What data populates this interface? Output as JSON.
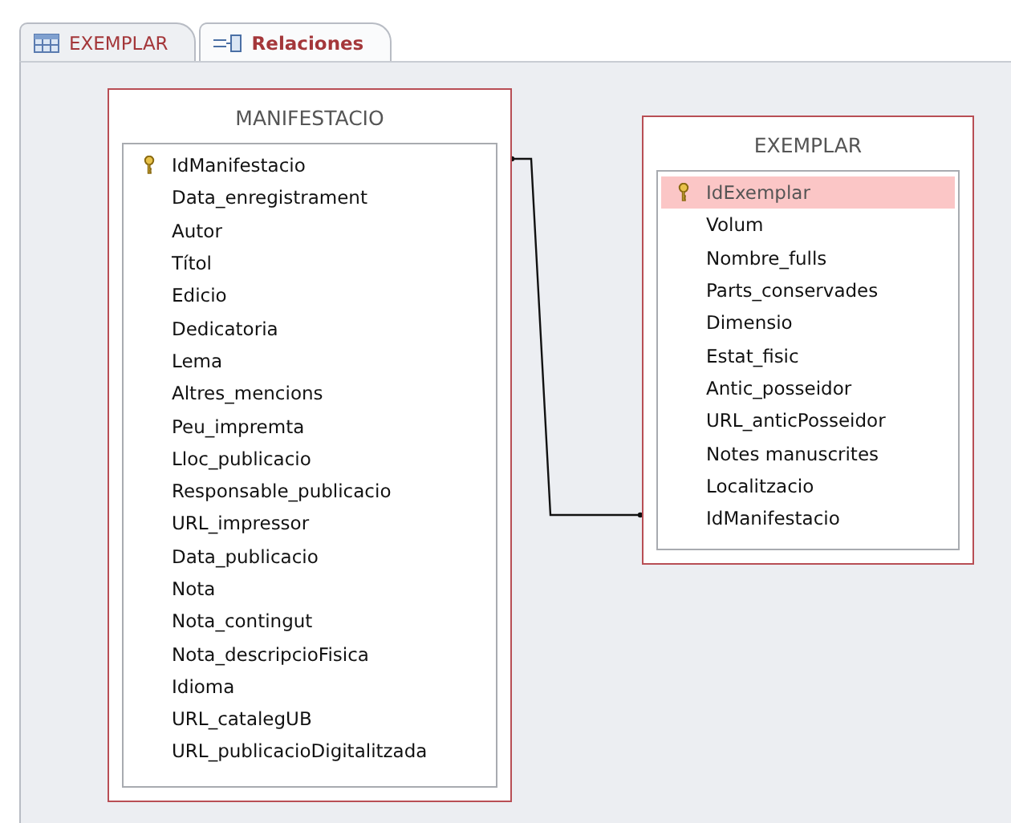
{
  "tabs": [
    {
      "label": "EXEMPLAR",
      "kind": "table",
      "selected": false
    },
    {
      "label": "Relaciones",
      "kind": "relations",
      "selected": true
    }
  ],
  "tables": [
    {
      "title": "MANIFESTACIO",
      "fields": [
        {
          "name": "IdManifestacio",
          "key": true,
          "selected": false
        },
        {
          "name": "Data_enregistrament",
          "key": false,
          "selected": false
        },
        {
          "name": "Autor",
          "key": false,
          "selected": false
        },
        {
          "name": "Títol",
          "key": false,
          "selected": false
        },
        {
          "name": "Edicio",
          "key": false,
          "selected": false
        },
        {
          "name": "Dedicatoria",
          "key": false,
          "selected": false
        },
        {
          "name": "Lema",
          "key": false,
          "selected": false
        },
        {
          "name": "Altres_mencions",
          "key": false,
          "selected": false
        },
        {
          "name": "Peu_impremta",
          "key": false,
          "selected": false
        },
        {
          "name": "Lloc_publicacio",
          "key": false,
          "selected": false
        },
        {
          "name": "Responsable_publicacio",
          "key": false,
          "selected": false
        },
        {
          "name": "URL_impressor",
          "key": false,
          "selected": false
        },
        {
          "name": "Data_publicacio",
          "key": false,
          "selected": false
        },
        {
          "name": "Nota",
          "key": false,
          "selected": false
        },
        {
          "name": "Nota_contingut",
          "key": false,
          "selected": false
        },
        {
          "name": "Nota_descripcioFisica",
          "key": false,
          "selected": false
        },
        {
          "name": "Idioma",
          "key": false,
          "selected": false
        },
        {
          "name": "URL_catalegUB",
          "key": false,
          "selected": false
        },
        {
          "name": "URL_publicacioDigitalitzada",
          "key": false,
          "selected": false
        }
      ]
    },
    {
      "title": "EXEMPLAR",
      "fields": [
        {
          "name": "IdExemplar",
          "key": true,
          "selected": true
        },
        {
          "name": "Volum",
          "key": false,
          "selected": false
        },
        {
          "name": "Nombre_fulls",
          "key": false,
          "selected": false
        },
        {
          "name": "Parts_conservades",
          "key": false,
          "selected": false
        },
        {
          "name": "Dimensio",
          "key": false,
          "selected": false
        },
        {
          "name": "Estat_fisic",
          "key": false,
          "selected": false
        },
        {
          "name": "Antic_posseidor",
          "key": false,
          "selected": false
        },
        {
          "name": "URL_anticPosseidor",
          "key": false,
          "selected": false
        },
        {
          "name": "Notes manuscrites",
          "key": false,
          "selected": false
        },
        {
          "name": "Localitzacio",
          "key": false,
          "selected": false
        },
        {
          "name": "IdManifestacio",
          "key": false,
          "selected": false
        }
      ]
    }
  ]
}
